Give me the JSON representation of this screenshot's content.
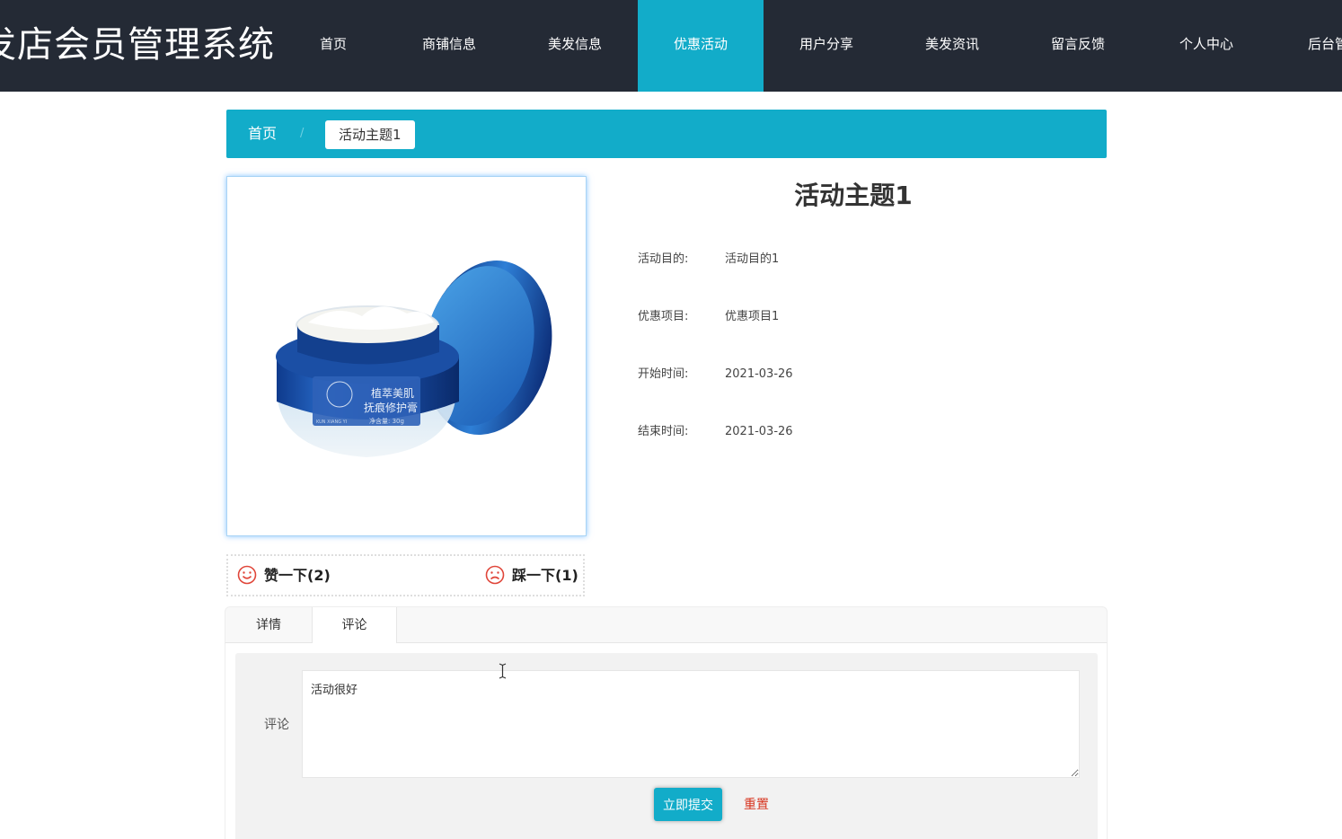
{
  "header": {
    "site_title": "发店会员管理系统",
    "nav": [
      {
        "label": "首页",
        "active": false
      },
      {
        "label": "商铺信息",
        "active": false
      },
      {
        "label": "美发信息",
        "active": false
      },
      {
        "label": "优惠活动",
        "active": true
      },
      {
        "label": "用户分享",
        "active": false
      },
      {
        "label": "美发资讯",
        "active": false
      },
      {
        "label": "留言反馈",
        "active": false
      },
      {
        "label": "个人中心",
        "active": false
      },
      {
        "label": "后台管",
        "active": false
      }
    ]
  },
  "breadcrumb": {
    "home": "首页",
    "separator": "/",
    "current": "活动主题1"
  },
  "product": {
    "image_icon": "face-cream-jar-image",
    "jar_text_line1": "植萃美肌",
    "jar_text_line2": "抚痕修护膏",
    "jar_text_line3": "净含量: 30g",
    "jar_logo_text": "KUN XIANG YI"
  },
  "detail": {
    "title": "活动主题1",
    "rows": [
      {
        "label": "活动目的:",
        "value": "活动目的1"
      },
      {
        "label": "优惠项目:",
        "value": "优惠项目1"
      },
      {
        "label": "开始时间:",
        "value": "2021-03-26"
      },
      {
        "label": "结束时间:",
        "value": "2021-03-26"
      }
    ]
  },
  "vote": {
    "like_label": "赞一下(2)",
    "dislike_label": "踩一下(1)",
    "like_icon": "smile-icon",
    "dislike_icon": "frown-icon"
  },
  "tabs": [
    {
      "label": "详情",
      "active": false
    },
    {
      "label": "评论",
      "active": true
    }
  ],
  "comment_form": {
    "label": "评论",
    "value": "活动很好",
    "submit_label": "立即提交",
    "reset_label": "重置"
  },
  "colors": {
    "header_bg": "#242a35",
    "accent": "#12acc9",
    "reset": "#d7341f",
    "vote_icon": "#e0463a"
  }
}
